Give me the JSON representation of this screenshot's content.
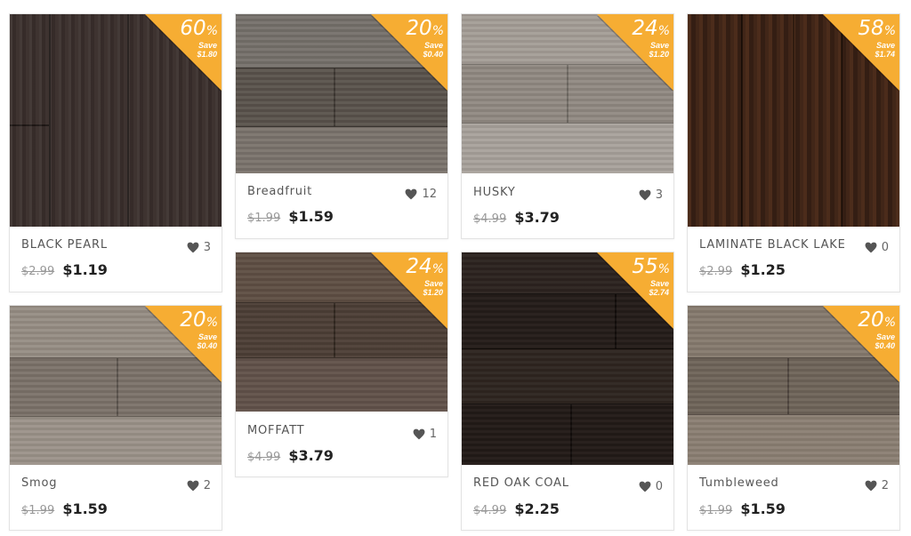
{
  "products": [
    {
      "name": "BLACK PEARL",
      "likes": "3",
      "old_price": "$2.99",
      "new_price": "$1.19",
      "discount": "60",
      "save": "Save",
      "save_amount": "$1.80",
      "colors": [
        "#3a2f2c",
        "#4a3b35",
        "#2c2421"
      ]
    },
    {
      "name": "Breadfruit",
      "likes": "12",
      "old_price": "$1.99",
      "new_price": "$1.59",
      "discount": "20",
      "save": "Save",
      "save_amount": "$0.40",
      "colors": [
        "#6e6761",
        "#575049",
        "#7d766f"
      ]
    },
    {
      "name": "HUSKY",
      "likes": "3",
      "old_price": "$4.99",
      "new_price": "$3.79",
      "discount": "24",
      "save": "Save",
      "save_amount": "$1.20",
      "colors": [
        "#9c958e",
        "#a9a29a",
        "#8f8881"
      ]
    },
    {
      "name": "LAMINATE BLACK LAKE",
      "likes": "0",
      "old_price": "$2.99",
      "new_price": "$1.25",
      "discount": "58",
      "save": "Save",
      "save_amount": "$1.74",
      "colors": [
        "#3b2216",
        "#5a3520",
        "#2a1810"
      ]
    },
    {
      "name": "Smog",
      "likes": "2",
      "old_price": "$1.99",
      "new_price": "$1.59",
      "discount": "20",
      "save": "Save",
      "save_amount": "$0.40",
      "colors": [
        "#8b8279",
        "#7a7168",
        "#9a9188"
      ]
    },
    {
      "name": "MOFFATT",
      "likes": "1",
      "old_price": "$4.99",
      "new_price": "$3.79",
      "discount": "24",
      "save": "Save",
      "save_amount": "$1.20",
      "colors": [
        "#5a4a40",
        "#4a3d35",
        "#65554a"
      ]
    },
    {
      "name": "RED OAK COAL",
      "likes": "0",
      "old_price": "$4.99",
      "new_price": "$2.25",
      "discount": "55",
      "save": "Save",
      "save_amount": "$2.74",
      "colors": [
        "#2a211d",
        "#231b18",
        "#33281f"
      ]
    },
    {
      "name": "Tumbleweed",
      "likes": "2",
      "old_price": "$1.99",
      "new_price": "$1.59",
      "discount": "20",
      "save": "Save",
      "save_amount": "$0.40",
      "colors": [
        "#7c7064",
        "#8a7e72",
        "#6e6358"
      ]
    }
  ],
  "badge_color": "#f6ad33",
  "icons": {
    "like": "heart-icon"
  }
}
